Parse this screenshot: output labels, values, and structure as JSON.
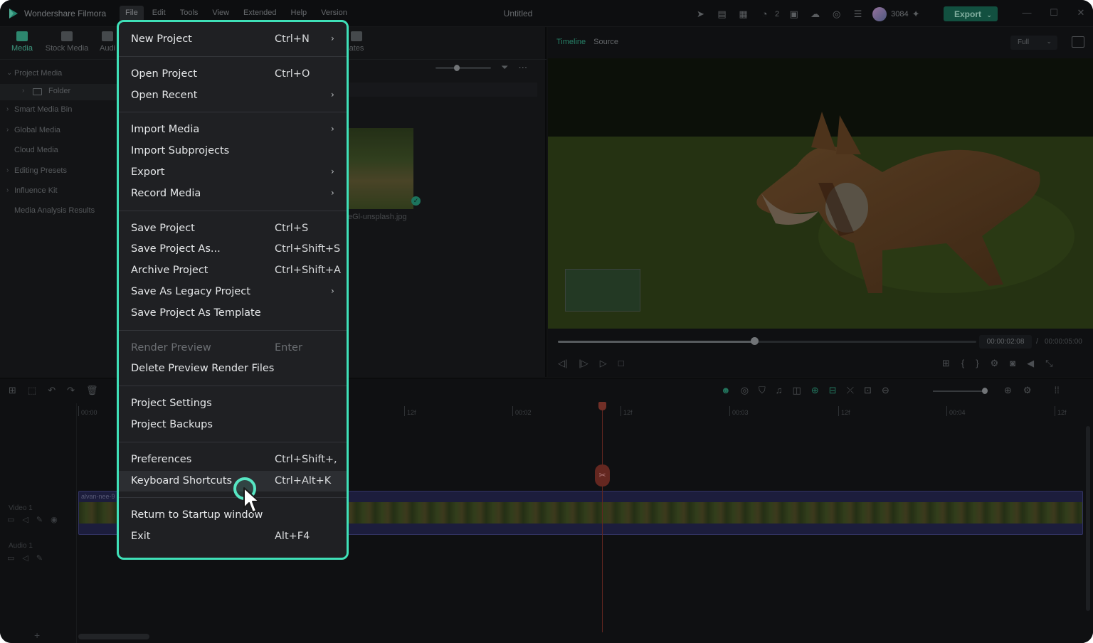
{
  "app": {
    "name": "Wondershare Filmora",
    "window_title": "Untitled"
  },
  "menubar": [
    "File",
    "Edit",
    "Tools",
    "View",
    "Extended",
    "Help",
    "Version"
  ],
  "titlebar": {
    "comment_count": "2",
    "credits": "3084",
    "export_label": "Export",
    "brand_color": "#17624f"
  },
  "media_tabs": [
    "Media",
    "Stock Media",
    "Audi",
    "ates"
  ],
  "sidebar": {
    "project_media": "Project Media",
    "folder": "Folder",
    "items": [
      "Smart Media Bin",
      "Global Media",
      "Cloud Media",
      "Editing Presets",
      "Influence Kit",
      "Media Analysis Results"
    ]
  },
  "media": {
    "thumb_name": "eGl-unsplash.jpg"
  },
  "preview": {
    "tabs": [
      "Timeline",
      "Source"
    ],
    "quality": "Full",
    "time_current": "00:00:02:08",
    "time_sep": "/",
    "time_total": "00:00:05:00",
    "progress": 0.47
  },
  "timeline": {
    "ruler_labels": [
      "00:00",
      "12f",
      "00:02",
      "12f",
      "00:03",
      "12f",
      "00:04",
      "12f"
    ],
    "tracks": {
      "video": "Video 1",
      "audio": "Audio 1"
    },
    "clip_name": "alvan-nee-9"
  },
  "file_menu": {
    "groups": [
      [
        {
          "label": "New Project",
          "shortcut": "Ctrl+N",
          "submenu": true
        }
      ],
      [
        {
          "label": "Open Project",
          "shortcut": "Ctrl+O",
          "submenu": false
        },
        {
          "label": "Open Recent",
          "shortcut": "",
          "submenu": true
        }
      ],
      [
        {
          "label": "Import Media",
          "shortcut": "",
          "submenu": true
        },
        {
          "label": "Import Subprojects",
          "shortcut": "",
          "submenu": false
        },
        {
          "label": "Export",
          "shortcut": "",
          "submenu": true
        },
        {
          "label": "Record Media",
          "shortcut": "",
          "submenu": true
        }
      ],
      [
        {
          "label": "Save Project",
          "shortcut": "Ctrl+S",
          "submenu": false
        },
        {
          "label": "Save Project As...",
          "shortcut": "Ctrl+Shift+S",
          "submenu": false
        },
        {
          "label": "Archive Project",
          "shortcut": "Ctrl+Shift+A",
          "submenu": false
        },
        {
          "label": "Save As Legacy Project",
          "shortcut": "",
          "submenu": true
        },
        {
          "label": "Save Project As Template",
          "shortcut": "",
          "submenu": false
        }
      ],
      [
        {
          "label": "Render Preview",
          "shortcut": "Enter",
          "submenu": false,
          "disabled": true
        },
        {
          "label": "Delete Preview Render Files",
          "shortcut": "",
          "submenu": false
        }
      ],
      [
        {
          "label": "Project Settings",
          "shortcut": "",
          "submenu": false
        },
        {
          "label": "Project Backups",
          "shortcut": "",
          "submenu": false
        }
      ],
      [
        {
          "label": "Preferences",
          "shortcut": "Ctrl+Shift+,",
          "submenu": false
        },
        {
          "label": "Keyboard Shortcuts",
          "shortcut": "Ctrl+Alt+K",
          "submenu": false,
          "hover": true
        }
      ],
      [
        {
          "label": "Return to Startup window",
          "shortcut": "",
          "submenu": false
        },
        {
          "label": "Exit",
          "shortcut": "Alt+F4",
          "submenu": false
        }
      ]
    ],
    "highlight_color": "#3fe0b8"
  }
}
